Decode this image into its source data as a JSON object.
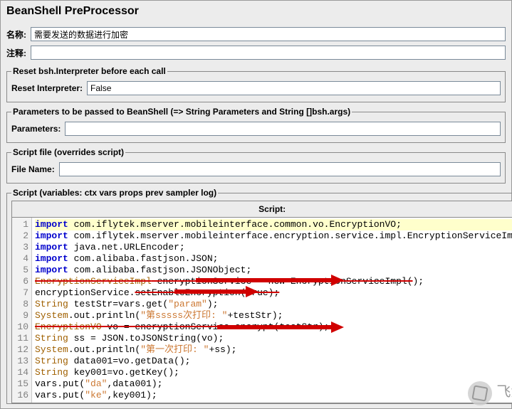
{
  "panelTitle": "BeanShell PreProcessor",
  "labels": {
    "name": "名称:",
    "comment": "注释:",
    "resetGroup": "Reset bsh.Interpreter before each call",
    "resetInterpreter": "Reset Interpreter:",
    "paramsGroup": "Parameters to be passed to BeanShell (=> String Parameters and String []bsh.args)",
    "parameters": "Parameters:",
    "scriptFileGroup": "Script file (overrides script)",
    "fileName": "File Name:",
    "scriptGroup": "Script (variables: ctx vars props prev sampler log)",
    "scriptHeader": "Script:"
  },
  "values": {
    "name": "需要发送的数据进行加密",
    "comment": "",
    "resetInterpreter": "False",
    "parameters": "",
    "fileName": ""
  },
  "code": {
    "l1_import": "import",
    "l1_rest": " com.iflytek.mserver.mobileinterface.common.vo.EncryptionVO;",
    "l2_import": "import",
    "l2_rest": " com.iflytek.mserver.mobileinterface.encryption.service.impl.EncryptionServiceImpl;",
    "l3_import": "import",
    "l3_rest": " java.net.URLEncoder;",
    "l4_import": "import",
    "l4_rest": " com.alibaba.fastjson.JSON;",
    "l5_import": "import",
    "l5_rest": " com.alibaba.fastjson.JSONObject;",
    "l6a": "EncryptionServiceImpl",
    "l6b": " encryptionService = new EncryptionServiceImpl(",
    "l6c": ");",
    "l7a": "encryptionService.",
    "l7b": "setEnableEncryption(true);",
    "l8a": "String",
    "l8b": " testStr=vars.get(",
    "l8c": "\"param\"",
    "l8d": ");",
    "l9a": "System",
    "l9b": ".out.println(",
    "l9c": "\"第sssss次打印: \"",
    "l9d": "+testStr);",
    "l10a": "EncryptionVO",
    "l10b": " vo = encryptionService.encrypt(testStr);",
    "l11a": "String",
    "l11b": " ss = JSON.toJSONString(vo);",
    "l12a": "System",
    "l12b": ".out.println(",
    "l12c": "\"第一次打印: \"",
    "l12d": "+ss);",
    "l13a": "String",
    "l13b": " data001=vo.getData();",
    "l14a": "String",
    "l14b": " key001=vo.getKey();",
    "l15a": "vars.put(",
    "l15b": "\"da\"",
    "l15c": ",data001);",
    "l16a": "vars.put(",
    "l16b": "\"ke\"",
    "l16c": ",key001);"
  },
  "watermark": "飞测"
}
